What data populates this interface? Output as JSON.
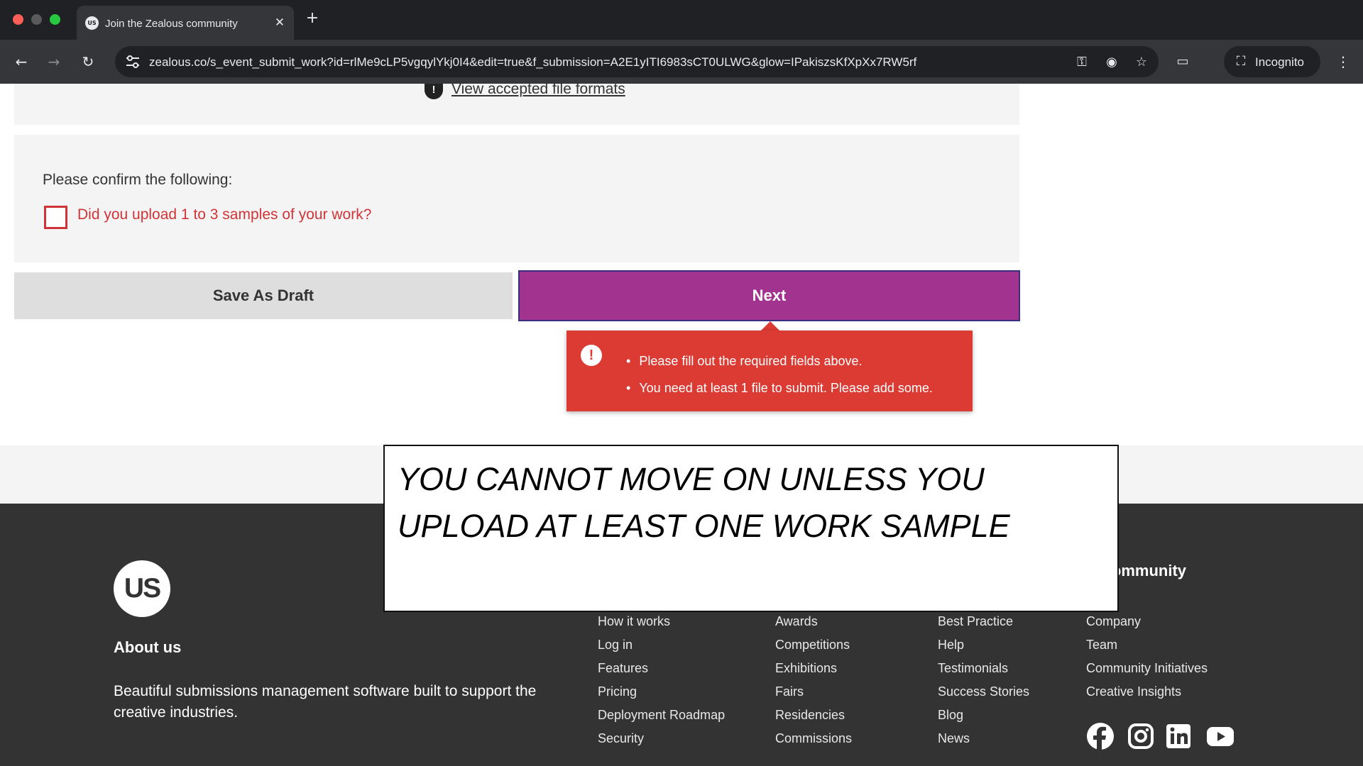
{
  "browser": {
    "tab_title": "Join the Zealous community",
    "favicon_text": "US",
    "url": "zealous.co/s_event_submit_work?id=rlMe9cLP5vgqylYkj0I4&edit=true&f_submission=A2E1yITI6983sCT0ULWG&glow=IPakiszsKfXpXx7RW5rf",
    "incognito_label": "Incognito"
  },
  "form": {
    "file_formats_link": "View accepted file formats",
    "confirm_heading": "Please confirm the following:",
    "confirm_label": "Did you upload 1 to 3 samples of your work?",
    "save_draft_label": "Save As Draft",
    "next_label": "Next",
    "errors": [
      "Please fill out the required fields above.",
      "You need at least 1 file to submit. Please add some."
    ]
  },
  "callout": {
    "text": "YOU CANNOT MOVE ON UNLESS YOU UPLOAD AT LEAST ONE WORK SAMPLE"
  },
  "footer": {
    "logo_text": "US",
    "about_title": "About us",
    "about_text": "Beautiful submissions management software built to support the creative industries.",
    "community_heading": "Community",
    "columns": [
      [
        "How it works",
        "Log in",
        "Features",
        "Pricing",
        "Deployment Roadmap",
        "Security"
      ],
      [
        "Awards",
        "Competitions",
        "Exhibitions",
        "Fairs",
        "Residencies",
        "Commissions"
      ],
      [
        "Best Practice",
        "Help",
        "Testimonials",
        "Success Stories",
        "Blog",
        "News"
      ],
      [
        "Company",
        "Team",
        "Community Initiatives",
        "Creative Insights"
      ]
    ]
  },
  "colors": {
    "accent": "#a2338e",
    "error": "#db3b33",
    "footer_bg": "#333333"
  }
}
